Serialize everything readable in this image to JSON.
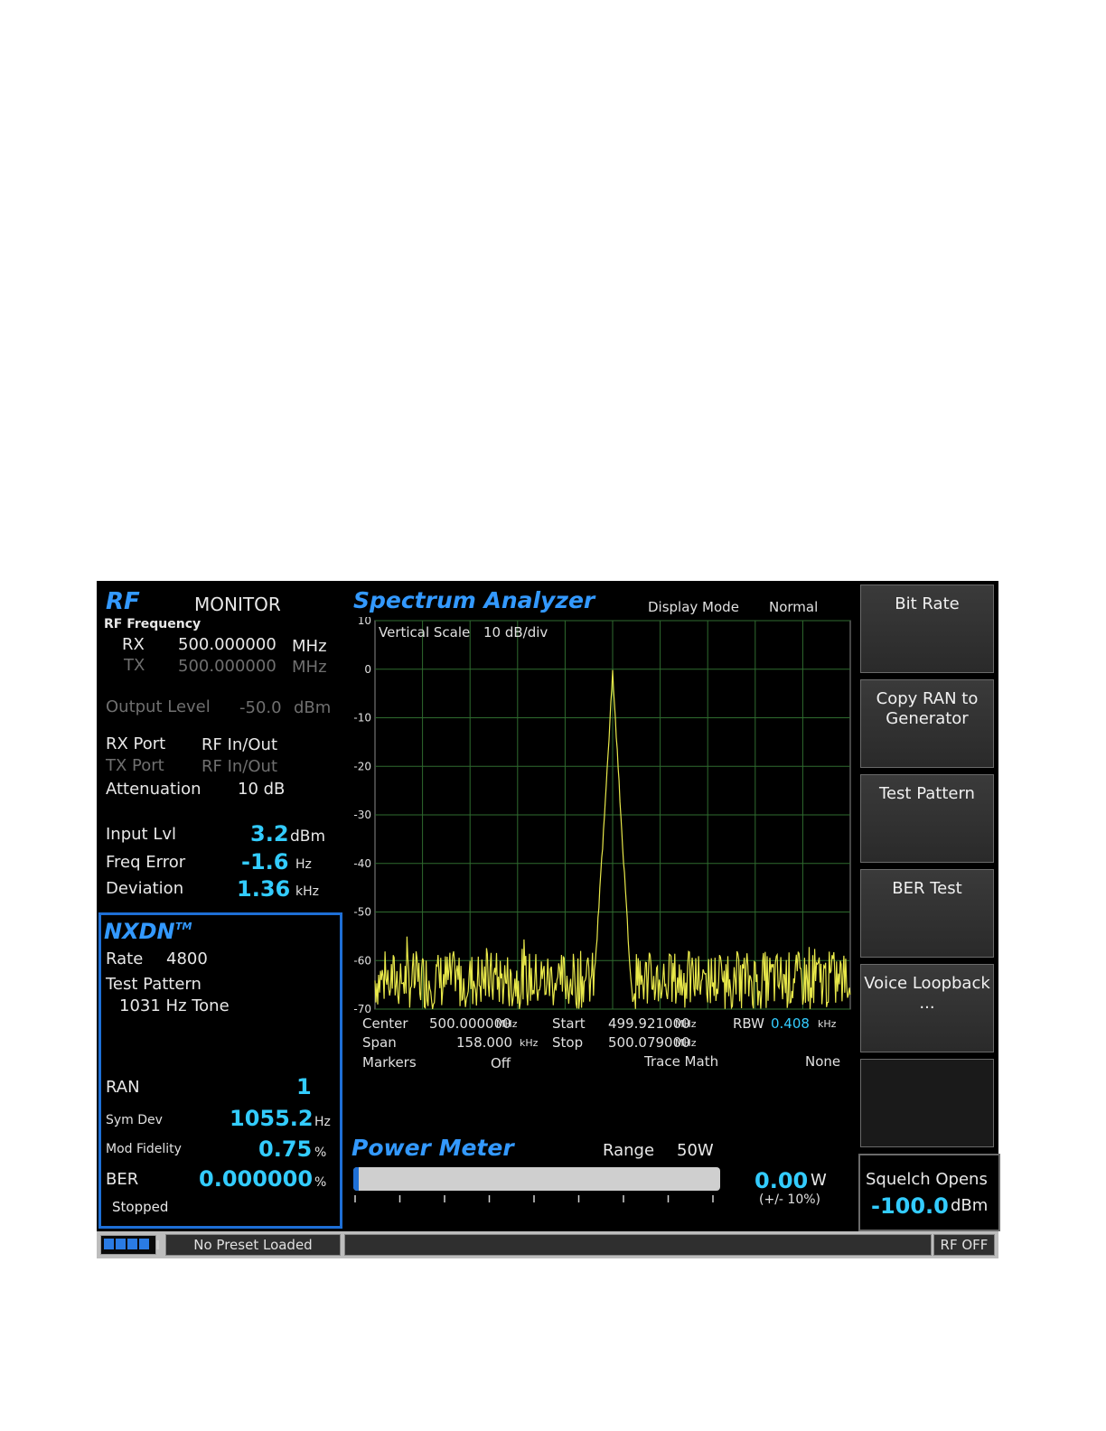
{
  "rf": {
    "title": "RF",
    "mode": "MONITOR",
    "freq_label": "RF Frequency",
    "rx_label": "RX",
    "rx_value": "500.000000",
    "rx_unit": "MHz",
    "tx_label": "TX",
    "tx_value": "500.000000",
    "tx_unit": "MHz",
    "output_level_label": "Output Level",
    "output_level_value": "-50.0",
    "output_level_unit": "dBm",
    "rx_port_label": "RX Port",
    "rx_port_value": "RF In/Out",
    "tx_port_label": "TX Port",
    "tx_port_value": "RF In/Out",
    "attenuation_label": "Attenuation",
    "attenuation_value": "10 dB",
    "input_lvl_label": "Input Lvl",
    "input_lvl_value": "3.2",
    "input_lvl_unit": "dBm",
    "freq_error_label": "Freq Error",
    "freq_error_value": "-1.6",
    "freq_error_unit": "Hz",
    "deviation_label": "Deviation",
    "deviation_value": "1.36",
    "deviation_unit": "kHz"
  },
  "nxdn": {
    "title": "NXDN",
    "trademark": "TM",
    "rate_label": "Rate",
    "rate_value": "4800",
    "test_pattern_label": "Test Pattern",
    "test_pattern_value": "1031 Hz Tone",
    "ran_label": "RAN",
    "ran_value": "1",
    "sym_dev_label": "Sym Dev",
    "sym_dev_value": "1055.2",
    "sym_dev_unit": "Hz",
    "mod_fidelity_label": "Mod Fidelity",
    "mod_fidelity_value": "0.75",
    "mod_fidelity_unit": "%",
    "ber_label": "BER",
    "ber_value": "0.000000",
    "ber_unit": "%",
    "status": "Stopped"
  },
  "spectrum": {
    "title": "Spectrum Analyzer",
    "display_mode_label": "Display Mode",
    "display_mode_value": "Normal",
    "vertical_scale_label": "Vertical Scale",
    "vertical_scale_value": "10 dB/div",
    "center_label": "Center",
    "center_value": "500.000000",
    "center_unit": "MHz",
    "start_label": "Start",
    "start_value": "499.921000",
    "start_unit": "MHz",
    "rbw_label": "RBW",
    "rbw_value": "0.408",
    "rbw_unit": "kHz",
    "span_label": "Span",
    "span_value": "158.000",
    "span_unit": "kHz",
    "stop_label": "Stop",
    "stop_value": "500.079000",
    "stop_unit": "MHz",
    "markers_label": "Markers",
    "markers_value": "Off",
    "trace_math_label": "Trace Math",
    "trace_math_value": "None"
  },
  "chart_data": {
    "type": "line",
    "ylim": [
      -70,
      10
    ],
    "yticks": [
      "10",
      "0",
      "-10",
      "-20",
      "-30",
      "-40",
      "-50",
      "-60",
      "-70"
    ],
    "xlim": [
      499.921,
      500.079
    ],
    "grid": true,
    "trace_color": "#e8e84a",
    "noise_floor_db": -64,
    "noise_amplitude_db": 6,
    "peak_db": -1,
    "peak_x": 500.0,
    "peak_halfwidth_mhz": 0.006
  },
  "power_meter": {
    "title": "Power Meter",
    "range_label": "Range",
    "range_value": "50W",
    "value": "0.00",
    "unit": "W",
    "tolerance": "(+/- 10%)",
    "bar_fraction": 0.0
  },
  "softkeys": [
    {
      "label": "Bit Rate"
    },
    {
      "label": "Copy RAN to Generator"
    },
    {
      "label": "Test Pattern"
    },
    {
      "label": "BER Test"
    },
    {
      "label": "Voice Loopback ..."
    }
  ],
  "squelch": {
    "label": "Squelch Opens",
    "value": "-100.0",
    "unit": "dBm"
  },
  "statusbar": {
    "preset": "No Preset Loaded",
    "rf_state": "RF OFF"
  },
  "colors": {
    "accent_blue": "#3399ff",
    "value_cyan": "#33ccff",
    "grid_green": "#2f6b2f"
  }
}
